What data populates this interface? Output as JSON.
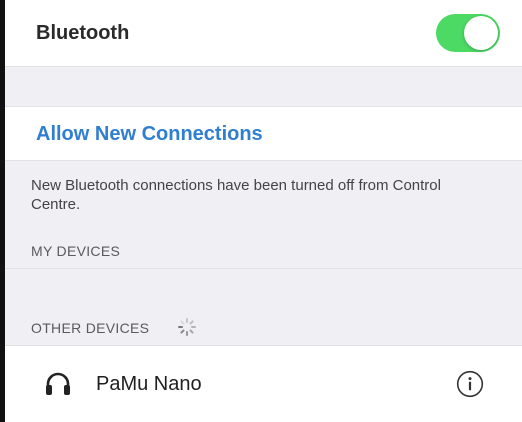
{
  "bluetooth": {
    "label": "Bluetooth",
    "enabled": true,
    "toggle_color": "#4cd964"
  },
  "allow_new_connections": {
    "label": "Allow New Connections",
    "color": "#2f7ed0"
  },
  "notice": {
    "text": "New Bluetooth connections have been turned off from Control Centre."
  },
  "sections": {
    "my_devices_header": "MY DEVICES",
    "other_devices_header": "OTHER DEVICES",
    "other_devices_loading": true
  },
  "devices": [
    {
      "name": "PaMu Nano",
      "icon": "headphones-icon",
      "info_icon": "info-icon"
    }
  ]
}
